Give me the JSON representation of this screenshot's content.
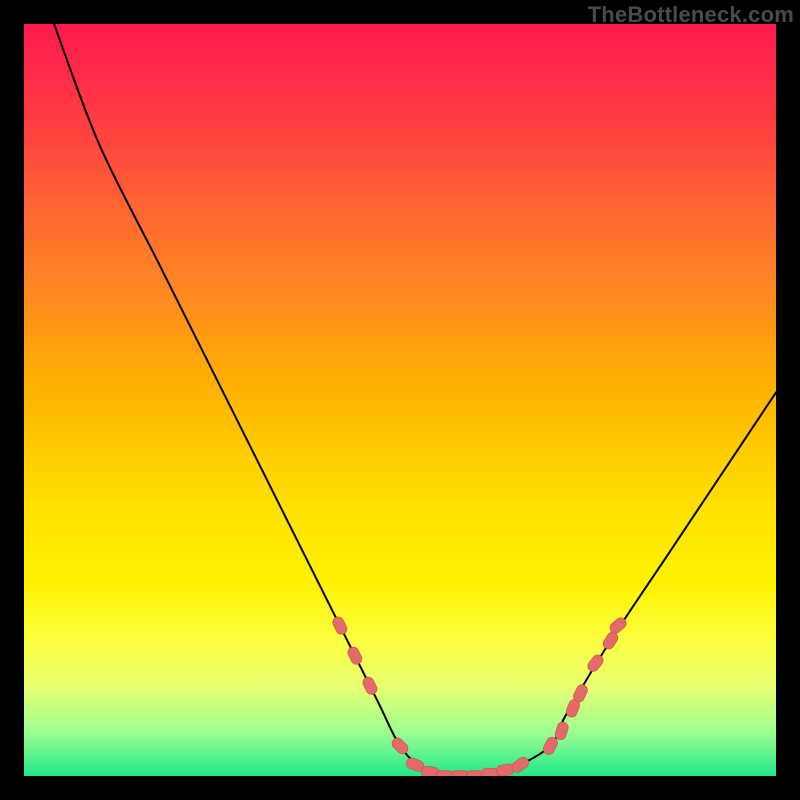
{
  "watermark": "TheBottleneck.com",
  "colors": {
    "background": "#000000",
    "curve": "#000000",
    "marker_fill": "#e46a6a",
    "marker_stroke": "#c94f4f"
  },
  "chart_data": {
    "type": "line",
    "title": "",
    "xlabel": "",
    "ylabel": "",
    "xlim": [
      0,
      100
    ],
    "ylim": [
      0,
      100
    ],
    "grid": false,
    "legend": false,
    "series": [
      {
        "name": "bottleneck-curve",
        "x": [
          4,
          10,
          18,
          26,
          34,
          42,
          47,
          50,
          53,
          56,
          59,
          62,
          65,
          70,
          72,
          78,
          86,
          94,
          100
        ],
        "y": [
          100,
          84,
          68,
          52,
          36,
          20,
          10,
          4,
          1,
          0,
          0,
          0,
          1,
          4,
          8,
          18,
          30,
          42,
          51
        ]
      }
    ],
    "markers": {
      "name": "highlight-points",
      "points": [
        {
          "x": 42,
          "y": 20
        },
        {
          "x": 44,
          "y": 16
        },
        {
          "x": 46,
          "y": 12
        },
        {
          "x": 50,
          "y": 4
        },
        {
          "x": 52,
          "y": 1.5
        },
        {
          "x": 54,
          "y": 0.5
        },
        {
          "x": 56,
          "y": 0
        },
        {
          "x": 58,
          "y": 0
        },
        {
          "x": 60,
          "y": 0
        },
        {
          "x": 62,
          "y": 0.3
        },
        {
          "x": 64,
          "y": 0.8
        },
        {
          "x": 66,
          "y": 1.5
        },
        {
          "x": 70,
          "y": 4
        },
        {
          "x": 71.5,
          "y": 6
        },
        {
          "x": 73,
          "y": 9
        },
        {
          "x": 74,
          "y": 11
        },
        {
          "x": 76,
          "y": 15
        },
        {
          "x": 78,
          "y": 18
        },
        {
          "x": 79,
          "y": 20
        }
      ]
    }
  }
}
